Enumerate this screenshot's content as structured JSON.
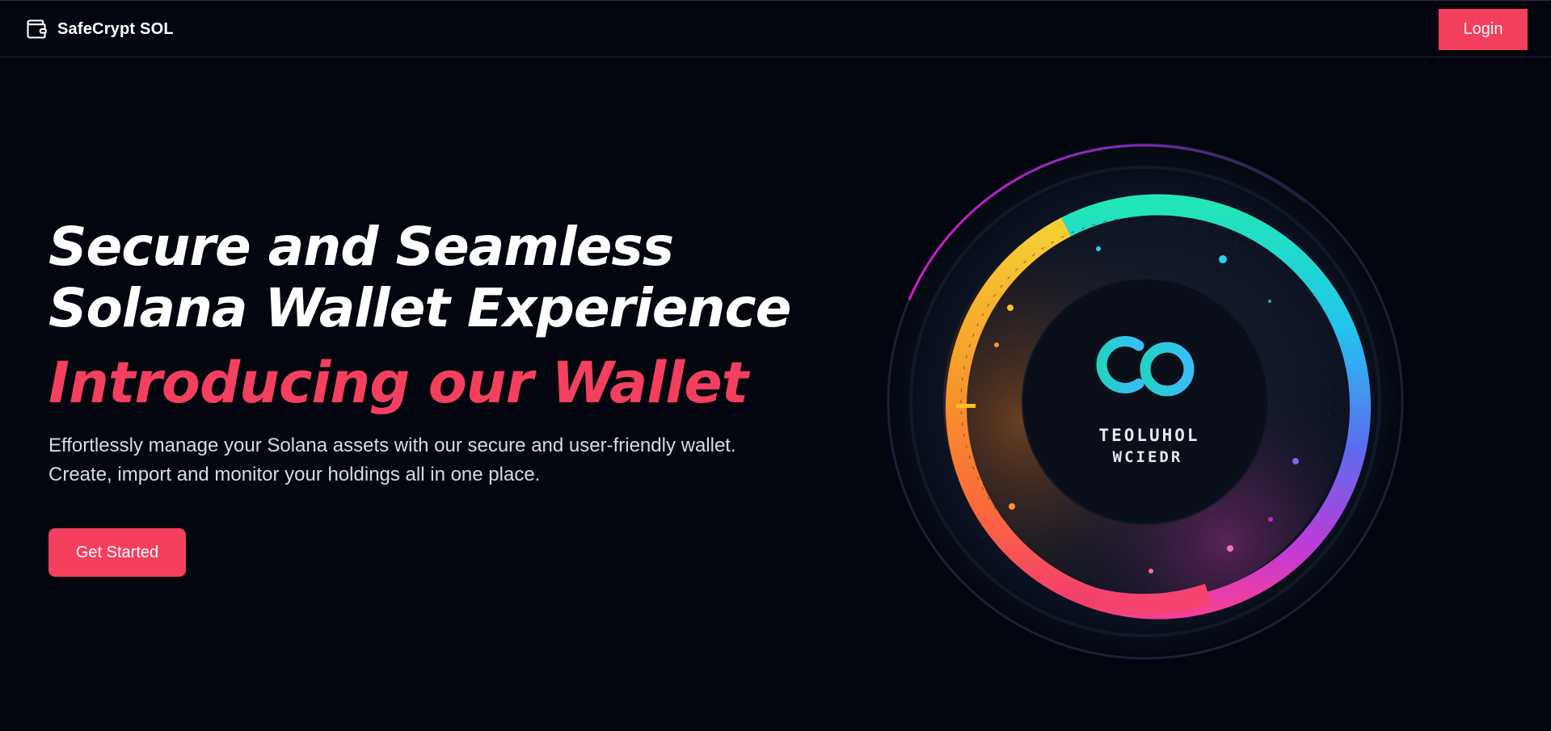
{
  "header": {
    "brand_name": "SafeCrypt SOL",
    "brand_icon": "wallet-icon",
    "login_label": "Login"
  },
  "hero": {
    "headline": "Secure and Seamless Solana Wallet Experience",
    "subheadline": "Introducing our Wallet",
    "description_line1": "Effortlessly manage your Solana assets with our secure and user-friendly wallet.",
    "description_line2": "Create, import and monitor your holdings all in one place.",
    "cta_label": "Get Started"
  },
  "artwork": {
    "logo_mark": "cb",
    "logo_text_line1": "TEOLUHOL",
    "logo_text_line2": "WCIEDR"
  },
  "colors": {
    "background": "#03060f",
    "accent": "#f43f5e",
    "text": "#ffffff",
    "muted_text": "#d7dbe4"
  }
}
